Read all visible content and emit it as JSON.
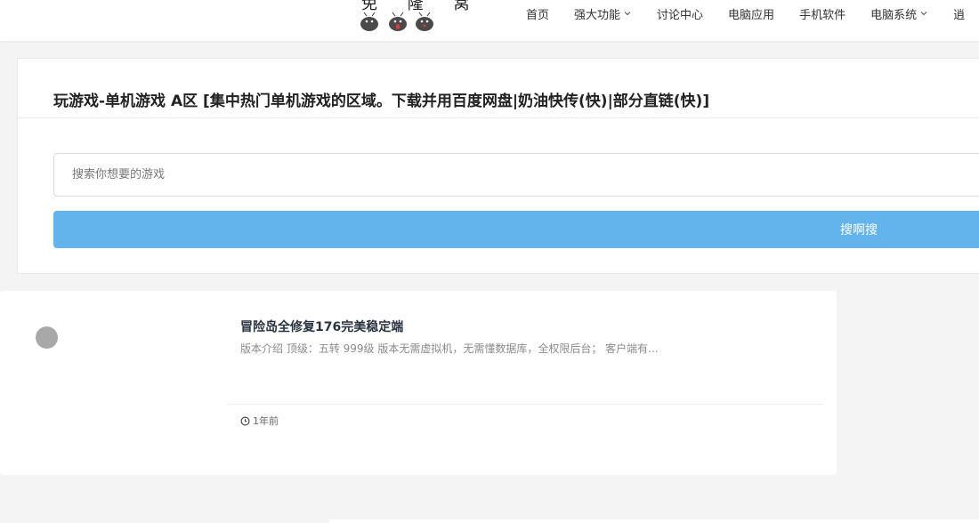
{
  "header": {
    "logo_text": "免 隆 窝",
    "nav": [
      {
        "label": "首页",
        "has_dropdown": false
      },
      {
        "label": "强大功能",
        "has_dropdown": true
      },
      {
        "label": "讨论中心",
        "has_dropdown": false
      },
      {
        "label": "电脑应用",
        "has_dropdown": false
      },
      {
        "label": "手机软件",
        "has_dropdown": false
      },
      {
        "label": "电脑系统",
        "has_dropdown": true
      },
      {
        "label": "逍",
        "has_dropdown": false
      }
    ]
  },
  "panel": {
    "title": "玩游戏-单机游戏 A区 [集中热门单机游戏的区域。下载并用百度网盘|奶油快传(快)|部分直链(快)]",
    "search": {
      "placeholder": "搜索你想要的游戏",
      "value": ""
    },
    "search_button": "搜啊搜"
  },
  "post": {
    "title": "冒险岛全修复176完美稳定端",
    "excerpt": "版本介绍 顶级：五转 999级 版本无需虚拟机，无需懂数据库，全权限后台； 客户端有...",
    "time": "1年前"
  },
  "colors": {
    "accent": "#63b3ed",
    "page_background": "#f4f4f4",
    "title_text": "#222222",
    "excerpt_text": "#8a8a8a"
  },
  "icons": {
    "dropdown": "chevron-down-icon",
    "time": "clock-icon",
    "logo": "bug-mascot-icon"
  }
}
